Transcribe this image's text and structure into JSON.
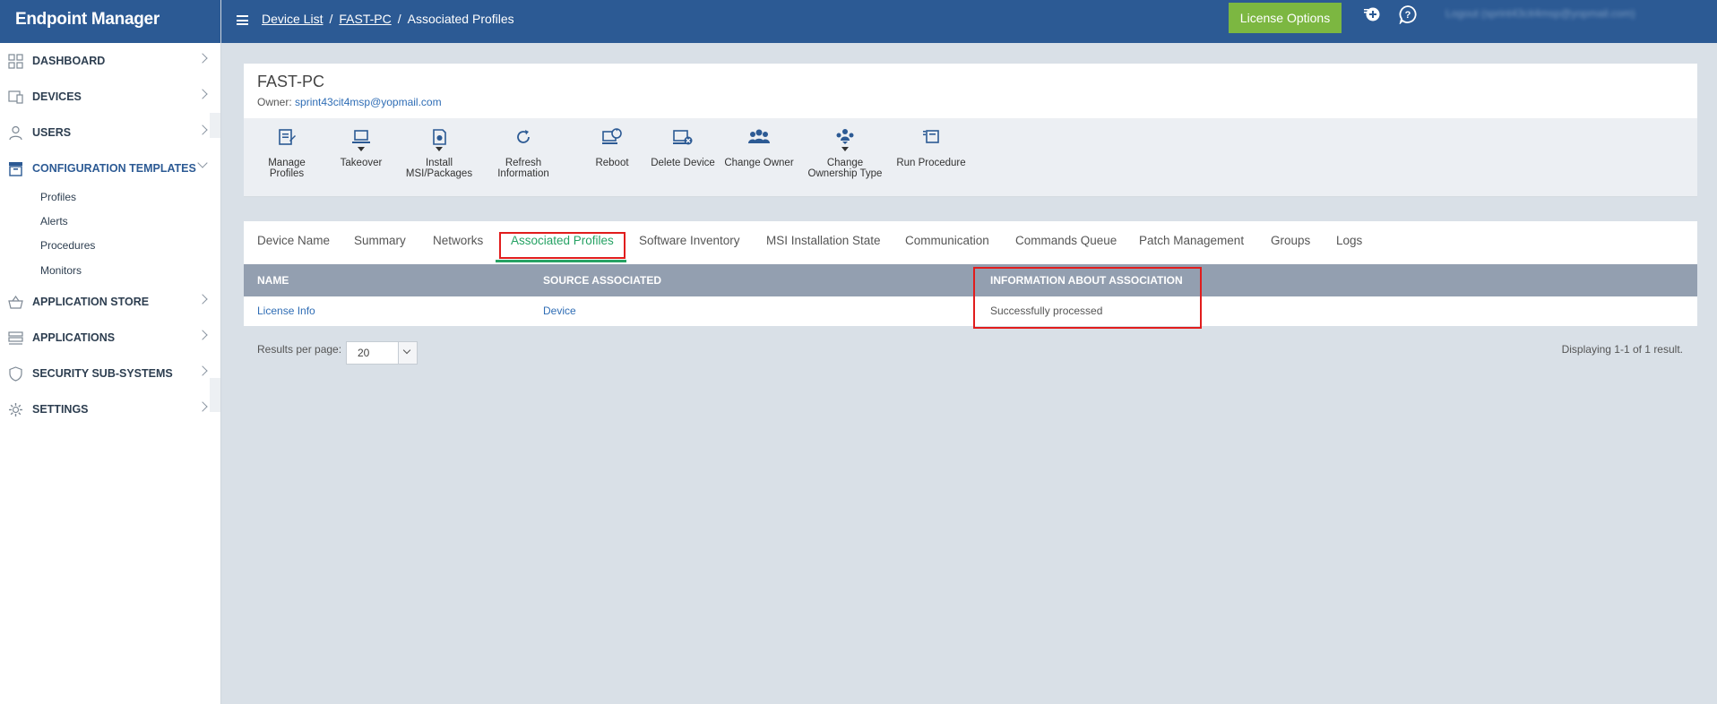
{
  "app": {
    "brand": "Endpoint Manager"
  },
  "sidebar": {
    "items": [
      {
        "label": "DASHBOARD",
        "icon": "dashboard-grid-icon"
      },
      {
        "label": "DEVICES",
        "icon": "devices-icon"
      },
      {
        "label": "USERS",
        "icon": "user-icon"
      },
      {
        "label": "CONFIGURATION TEMPLATES",
        "icon": "templates-icon"
      },
      {
        "label": "APPLICATION STORE",
        "icon": "basket-icon"
      },
      {
        "label": "APPLICATIONS",
        "icon": "applications-icon"
      },
      {
        "label": "SECURITY SUB-SYSTEMS",
        "icon": "shield-icon"
      },
      {
        "label": "SETTINGS",
        "icon": "gear-icon"
      }
    ],
    "subitems": [
      "Profiles",
      "Alerts",
      "Procedures",
      "Monitors"
    ]
  },
  "header": {
    "breadcrumb": [
      "Device List",
      "FAST-PC",
      "Associated Profiles"
    ],
    "license_button": "License Options",
    "user_text": "Logout (sprint43cit4msp@yopmail.com)"
  },
  "device": {
    "name": "FAST-PC",
    "owner_label": "Owner:",
    "owner_email": "sprint43cit4msp@yopmail.com"
  },
  "toolbar": {
    "manage_profiles": "Manage Profiles",
    "takeover": "Takeover",
    "install_line1": "Install",
    "install_line2": "MSI/Packages",
    "refresh_line1": "Refresh",
    "refresh_line2": "Information",
    "reboot": "Reboot",
    "delete_device": "Delete Device",
    "change_owner": "Change Owner",
    "change_type_line1": "Change",
    "change_type_line2": "Ownership Type",
    "run_procedure": "Run Procedure"
  },
  "tabs": [
    "Device Name",
    "Summary",
    "Networks",
    "Associated Profiles",
    "Software Inventory",
    "MSI Installation State",
    "Communication",
    "Commands Queue",
    "Patch Management",
    "Groups",
    "Logs"
  ],
  "active_tab": "Associated Profiles",
  "table": {
    "headers": [
      "NAME",
      "SOURCE ASSOCIATED",
      "INFORMATION ABOUT ASSOCIATION"
    ],
    "rows": [
      {
        "name": "License Info",
        "source": "Device",
        "info": "Successfully processed"
      }
    ]
  },
  "pagination": {
    "label": "Results per page:",
    "per_page": "20",
    "summary": "Displaying 1-1 of 1 result."
  },
  "colors": {
    "header_blue": "#2c5a94",
    "license_green": "#7cb741",
    "active_tab_green": "#26a264",
    "highlight_red": "#e11d1d"
  }
}
